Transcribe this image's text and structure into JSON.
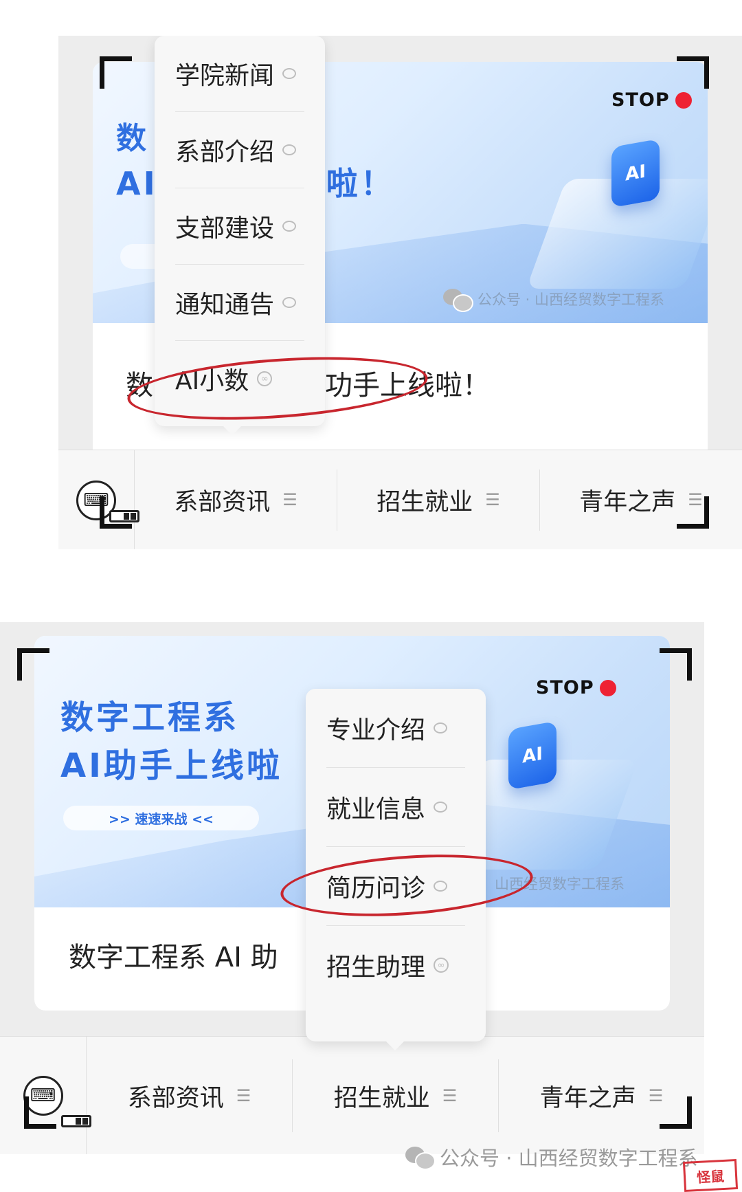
{
  "top": {
    "stop_label": "STOP",
    "banner_title_line1": "数",
    "banner_title_line2a": "AI",
    "banner_title_line2b": "啦！",
    "chip_label": "AI",
    "watermark": "公众号 · 山西经贸数字工程系",
    "caption_left": "数",
    "caption_right": "功手上线啦！",
    "menu": [
      {
        "label": "学院新闻",
        "icon": "chat-bubble-icon"
      },
      {
        "label": "系部介绍",
        "icon": "chat-bubble-icon"
      },
      {
        "label": "支部建设",
        "icon": "chat-bubble-icon"
      },
      {
        "label": "通知通告",
        "icon": "chat-bubble-icon"
      },
      {
        "label": "AI小数",
        "icon": "mini-program-icon",
        "highlighted": true
      }
    ],
    "tabs": [
      {
        "label": "系部资讯"
      },
      {
        "label": "招生就业"
      },
      {
        "label": "青年之声"
      }
    ]
  },
  "bottom": {
    "stop_label": "STOP",
    "banner_title_line1": "数字工程系",
    "banner_title_line2": "AI助手上线啦",
    "cta": ">> 速速来战 <<",
    "chip_label": "AI",
    "watermark": "山西经贸数字工程系",
    "caption": "数字工程系 AI 助",
    "menu": [
      {
        "label": "专业介绍",
        "icon": "chat-bubble-icon"
      },
      {
        "label": "就业信息",
        "icon": "chat-bubble-icon"
      },
      {
        "label": "简历问诊",
        "icon": "chat-bubble-icon"
      },
      {
        "label": "招生助理",
        "icon": "mini-program-icon",
        "highlighted": true
      }
    ],
    "tabs": [
      {
        "label": "系部资讯"
      },
      {
        "label": "招生就业"
      },
      {
        "label": "青年之声"
      }
    ]
  },
  "footer": {
    "text": "公众号 · 山西经贸数字工程系",
    "seal_text": "怪鼠"
  },
  "colors": {
    "accent_blue": "#2f6fe0",
    "stop_red": "#ee2233",
    "highlight_red": "#c8262e"
  }
}
